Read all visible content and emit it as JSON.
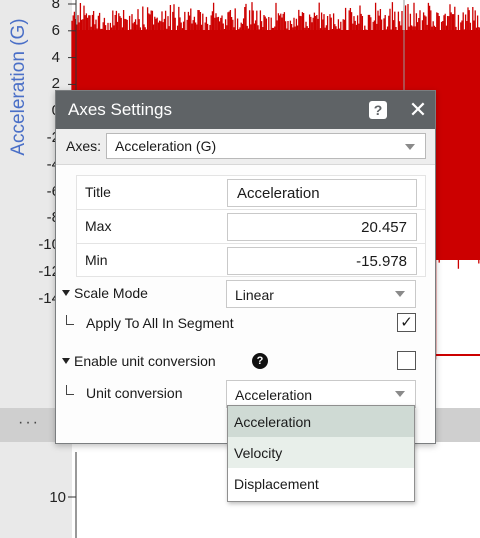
{
  "background_chart": {
    "y_axis_title": "Acceleration (G)",
    "upper_ticks": [
      "8",
      "6",
      "4",
      "2",
      "0",
      "-2",
      "-4",
      "-6",
      "-8",
      "-10",
      "-12",
      "-14"
    ],
    "lower_ticks": [
      "10"
    ],
    "separator": "···",
    "signal_color": "#cc0000"
  },
  "dialog": {
    "title": "Axes Settings",
    "help_symbol": "?",
    "close_symbol": "✕",
    "axes_label": "Axes:",
    "axes_selected": "Acceleration (G)",
    "title_label": "Title",
    "title_value": "Acceleration",
    "max_label": "Max",
    "max_value": "20.457",
    "min_label": "Min",
    "min_value": "-15.978",
    "scale_mode_label": "Scale Mode",
    "scale_mode_value": "Linear",
    "apply_all_label": "Apply To All In Segment",
    "apply_all_checked": true,
    "apply_all_check_glyph": "✓",
    "enable_conversion_label": "Enable unit conversion",
    "info_symbol": "?",
    "enable_conversion_checked": false,
    "unit_conversion_label": "Unit conversion",
    "unit_conversion_value": "Acceleration"
  },
  "unit_dropdown": {
    "options": [
      "Acceleration",
      "Velocity",
      "Displacement"
    ],
    "selected_index": 0,
    "hover_index": 1
  },
  "colors": {
    "titlebar": "#5f6366",
    "axis_title": "#4a6fc7",
    "signal": "#cc0000",
    "dropdown_selected": "#cfdad4"
  }
}
